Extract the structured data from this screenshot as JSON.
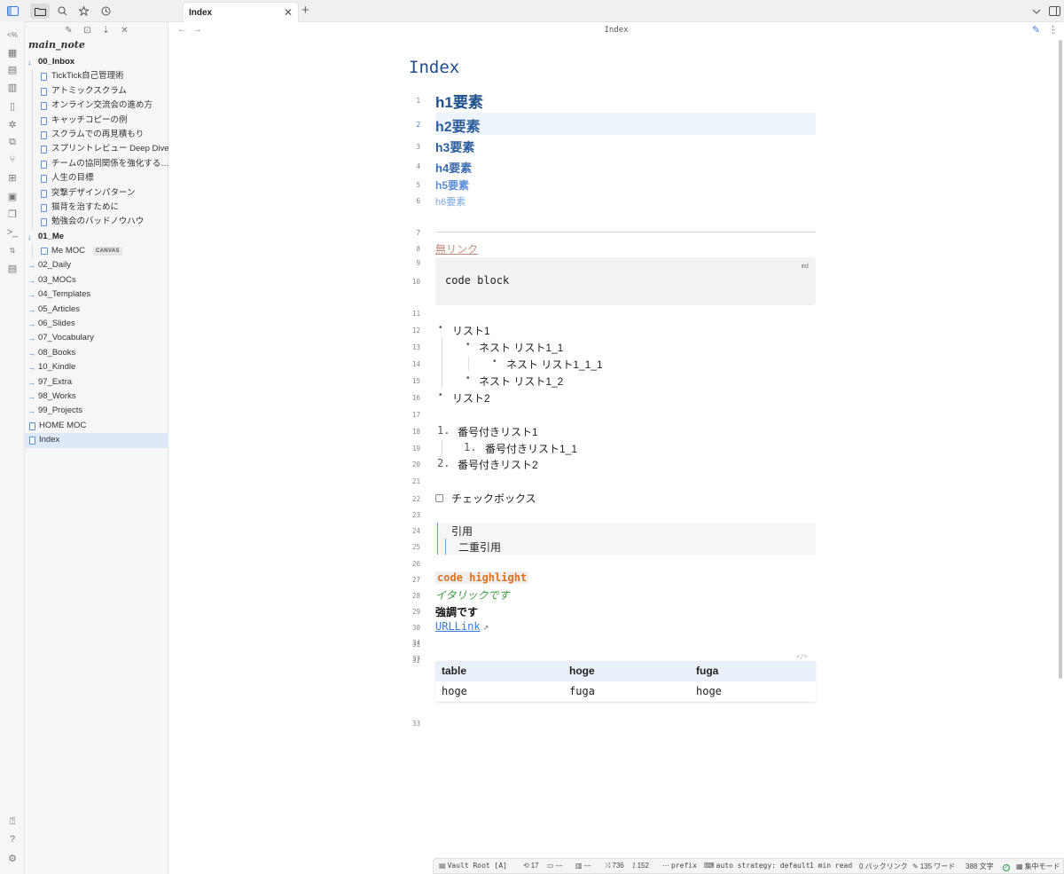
{
  "app": {
    "tab_title": "Index",
    "view_title": "Index",
    "vault_name": "main_note"
  },
  "sidebar": {
    "tree": [
      {
        "label": "00_Inbox",
        "type": "folder-open"
      },
      {
        "label": "TickTick自己管理術",
        "type": "file"
      },
      {
        "label": "アトミックスクラム",
        "type": "file"
      },
      {
        "label": "オンライン交流会の進め方",
        "type": "file"
      },
      {
        "label": "キャッチコピーの例",
        "type": "file"
      },
      {
        "label": "スクラムでの再見積もり",
        "type": "file"
      },
      {
        "label": "スプリントレビュー Deep Dive",
        "type": "file"
      },
      {
        "label": "チームの協同関係を強化する…",
        "type": "file"
      },
      {
        "label": "人生の目標",
        "type": "file"
      },
      {
        "label": "突撃デザインパターン",
        "type": "file"
      },
      {
        "label": "猫背を治すために",
        "type": "file"
      },
      {
        "label": "勉強会のバッドノウハウ",
        "type": "file"
      },
      {
        "label": "01_Me",
        "type": "folder-open"
      },
      {
        "label": "Me MOC",
        "type": "canvas",
        "badge": "CANVAS"
      },
      {
        "label": "02_Daily",
        "type": "folder"
      },
      {
        "label": "03_MOCs",
        "type": "folder"
      },
      {
        "label": "04_Templates",
        "type": "folder"
      },
      {
        "label": "05_Articles",
        "type": "folder"
      },
      {
        "label": "06_Slides",
        "type": "folder"
      },
      {
        "label": "07_Vocabulary",
        "type": "folder"
      },
      {
        "label": "08_Books",
        "type": "folder"
      },
      {
        "label": "10_Kindle",
        "type": "folder"
      },
      {
        "label": "97_Extra",
        "type": "folder"
      },
      {
        "label": "98_Works",
        "type": "folder"
      },
      {
        "label": "99_Projects",
        "type": "folder"
      },
      {
        "label": "HOME MOC",
        "type": "root-file"
      },
      {
        "label": "Index",
        "type": "root-file",
        "selected": true
      }
    ]
  },
  "editor": {
    "title": "Index",
    "h1": "h1要素",
    "h2": "h2要素",
    "h3": "h3要素",
    "h4": "h4要素",
    "h5": "h5要素",
    "h6": "h6要素",
    "dead_link": "無リンク",
    "code_lang": "md",
    "code_text": "code block",
    "list1": "リスト1",
    "list1_1": "ネスト リスト1_1",
    "list1_1_1": "ネスト リスト1_1_1",
    "list1_2": "ネスト リスト1_2",
    "list2": "リスト2",
    "ol1_num": "1.",
    "ol1": "番号付きリスト1",
    "ol1_1_num": "1.",
    "ol1_1": "番号付きリスト1_1",
    "ol2_num": "2.",
    "ol2": "番号付きリスト2",
    "checkbox": "チェックボックス",
    "quote1": "引用",
    "quote2": "二重引用",
    "code_highlight": "code highlight",
    "italic": "イタリックです",
    "bold": "強調です",
    "url_link": "URLLink",
    "table_icon": "</>",
    "table": {
      "header": [
        "table",
        "hoge",
        "fuga"
      ],
      "row": [
        "hoge",
        "fuga",
        "hoge"
      ]
    },
    "line_numbers": [
      "1",
      "2",
      "3",
      "4",
      "5",
      "6",
      "7",
      "8",
      "9",
      "10",
      "11",
      "12",
      "13",
      "14",
      "15",
      "16",
      "17",
      "18",
      "19",
      "20",
      "21",
      "22",
      "23",
      "24",
      "25",
      "26",
      "27",
      "28",
      "29",
      "30",
      "31",
      "32",
      "33",
      "34",
      "37"
    ]
  },
  "statusbar": {
    "vault_root": "Vault Root [A]",
    "backlinks": "17",
    "s2": "---",
    "s3": "---",
    "s4": "736",
    "s5": "152",
    "prefix": "prefix",
    "strategy": "auto strategy: default",
    "read": "1 min read",
    "backlink_count": "0 バックリンク",
    "words": "135 ワード",
    "chars": "388 文字",
    "focus": "集中モード"
  },
  "colors": {
    "accent": "#3b7dd8",
    "heading": "#1f4f8a",
    "code_highlight": "#e27020",
    "italic": "#3a9a3a"
  }
}
